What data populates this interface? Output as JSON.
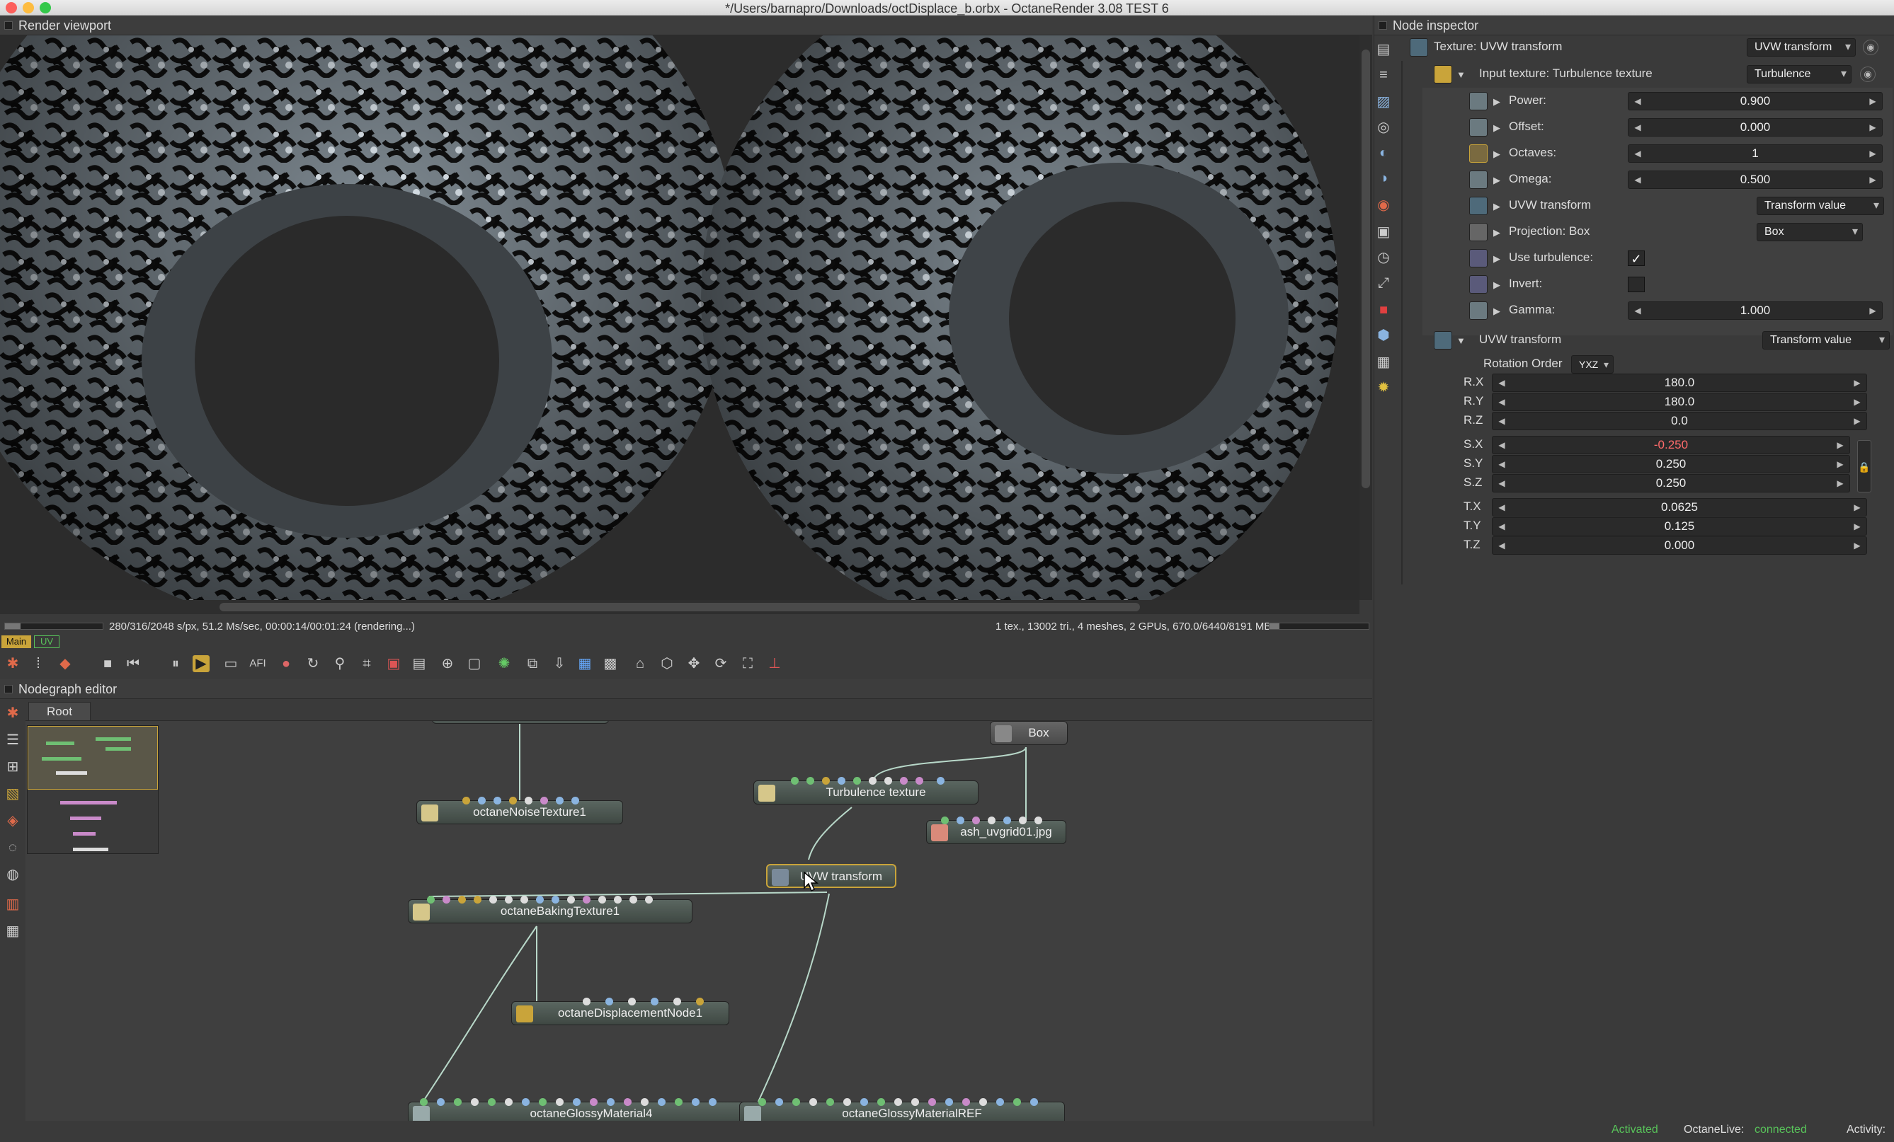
{
  "window": {
    "title": "*/Users/barnapro/Downloads/octDisplace_b.orbx - OctaneRender 3.08 TEST 6"
  },
  "viewport": {
    "header": "Render viewport"
  },
  "status": {
    "left": "280/316/2048 s/px, 51.2 Ms/sec, 00:00:14/00:01:24 (rendering...)",
    "right": "1 tex., 13002 tri., 4 meshes, 2 GPUs, 670.0/6440/8191 MB",
    "tab_main": "Main",
    "tab_uv": "UV"
  },
  "nodegraph": {
    "header": "Nodegraph editor",
    "tab_root": "Root",
    "nodes": {
      "noise": "octaneNoiseTexture1",
      "turbulence": "Turbulence texture",
      "box": "Box",
      "uvgrid": "ash_uvgrid01.jpg",
      "uvw": "UVW transform",
      "baking": "octaneBakingTexture1",
      "displacement": "octaneDisplacementNode1",
      "glossy4": "octaneGlossyMaterial4",
      "glossyref": "octaneGlossyMaterialREF"
    }
  },
  "inspector": {
    "header": "Node inspector",
    "texture_label": "Texture: UVW transform",
    "texture_dd": "UVW transform",
    "input_label": "Input texture: Turbulence texture",
    "input_dd": "Turbulence",
    "params": [
      {
        "label": "Power:",
        "value": "0.900"
      },
      {
        "label": "Offset:",
        "value": "0.000"
      },
      {
        "label": "Octaves:",
        "value": "1"
      },
      {
        "label": "Omega:",
        "value": "0.500"
      }
    ],
    "uvw_label": "UVW transform",
    "uvw_dd": "Transform value",
    "proj_label": "Projection: Box",
    "proj_dd": "Box",
    "use_turb_label": "Use turbulence:",
    "use_turb_checked": "✓",
    "invert_label": "Invert:",
    "gamma_label": "Gamma:",
    "gamma_value": "1.000",
    "uvw2_label": "UVW transform",
    "uvw2_dd": "Transform value",
    "rot_order_label": "Rotation Order",
    "rot_order_value": "YXZ",
    "transform": [
      {
        "label": "R.X",
        "value": "180.0"
      },
      {
        "label": "R.Y",
        "value": "180.0"
      },
      {
        "label": "R.Z",
        "value": "0.0"
      },
      {
        "label": "S.X",
        "value": "-0.250"
      },
      {
        "label": "S.Y",
        "value": "0.250"
      },
      {
        "label": "S.Z",
        "value": "0.250"
      },
      {
        "label": "T.X",
        "value": "0.0625"
      },
      {
        "label": "T.Y",
        "value": "0.125"
      },
      {
        "label": "T.Z",
        "value": "0.000"
      }
    ]
  },
  "bottom": {
    "activated": "Activated",
    "octanelive": "OctaneLive:",
    "connected": "connected",
    "activity": "Activity:"
  },
  "colors": {
    "accent_green": "#58c35a",
    "node_selected": "#c9a43a",
    "negative_value": "#ff6b6b"
  }
}
